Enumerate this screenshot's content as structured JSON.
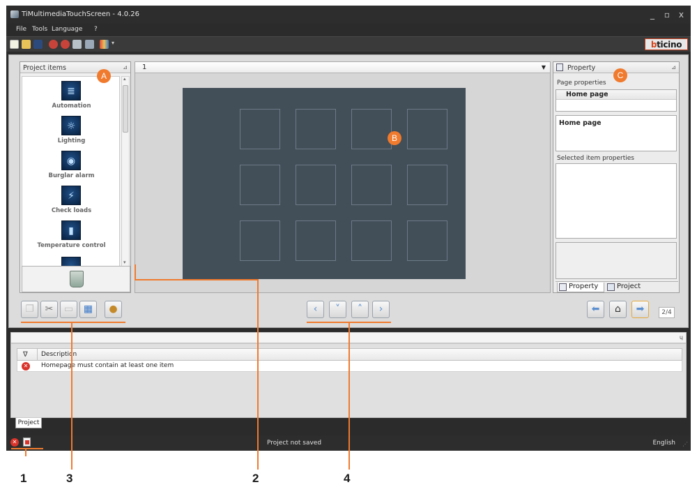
{
  "window": {
    "title": "TiMultimediaTouchScreen - 4.0.26",
    "min": "_",
    "max": "▫",
    "close": "x"
  },
  "menu": [
    "File",
    "Tools",
    "Language",
    "?"
  ],
  "brand": {
    "logo_prefix": "b",
    "logo_rest": "ticino"
  },
  "project_items": {
    "title": "Project items",
    "items": [
      {
        "label": "Automation",
        "icon": "automation-icon",
        "glyph": "≣"
      },
      {
        "label": "Lighting",
        "icon": "lighting-icon",
        "glyph": "☼"
      },
      {
        "label": "Burglar alarm",
        "icon": "burglar-alarm-icon",
        "glyph": "◉"
      },
      {
        "label": "Check loads",
        "icon": "check-loads-icon",
        "glyph": "⚡"
      },
      {
        "label": "Temperature control",
        "icon": "temperature-control-icon",
        "glyph": "▮"
      }
    ]
  },
  "page_selector": {
    "value": "1"
  },
  "property": {
    "title": "Property",
    "page_properties_label": "Page properties",
    "page_name": "Home page",
    "page_name_box": "Home page",
    "selected_item_label": "Selected item properties",
    "tabs": [
      "Property",
      "Project"
    ]
  },
  "navigation": {
    "page_count": "2/4"
  },
  "messages": {
    "column_header": "Description",
    "rows": [
      {
        "text": "Homepage must contain at least one item",
        "severity": "error"
      }
    ],
    "tab": "Project"
  },
  "status": {
    "text": "Project not saved",
    "language": "English"
  },
  "callouts": {
    "A": "A",
    "B": "B",
    "C": "C",
    "n1": "1",
    "n2": "2",
    "n3": "3",
    "n4": "4"
  },
  "colors": {
    "accent": "#f07a2d",
    "screen": "#424e58",
    "chrome": "#2b2b2b"
  }
}
